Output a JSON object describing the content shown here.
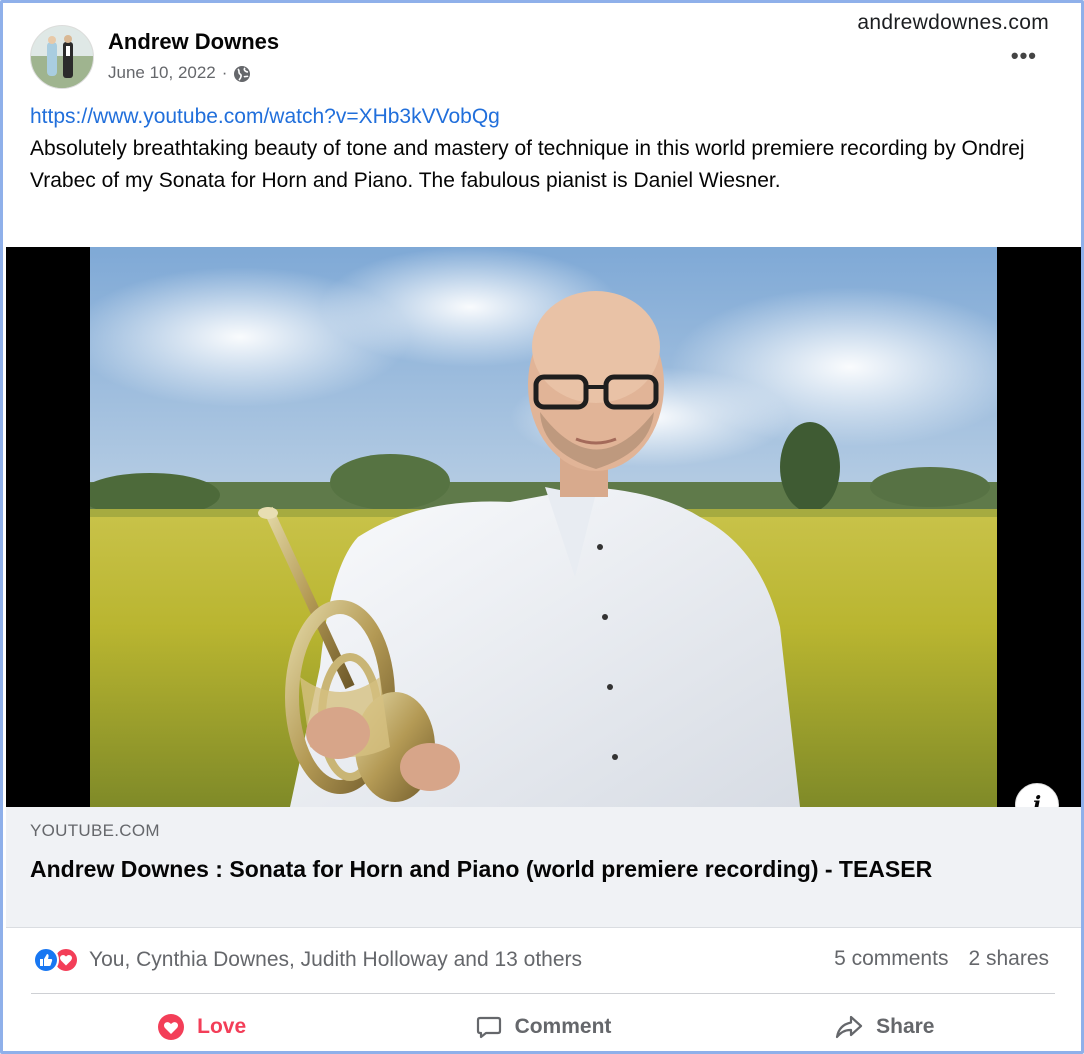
{
  "watermark": "andrewdownes.com",
  "post": {
    "author": "Andrew Downes",
    "date": "June 10, 2022",
    "separator": "·",
    "more_label": "•••",
    "link": "https://www.youtube.com/watch?v=XHb3kVVobQg",
    "text": "Absolutely breathtaking beauty of tone and mastery of technique in this world premiere recording by Ondrej Vrabec of my Sonata for Horn and Piano.  The fabulous pianist is Daniel Wiesner."
  },
  "link_preview": {
    "domain": "YOUTUBE.COM",
    "title": "Andrew Downes : Sonata for Horn and Piano (world premiere recording) - TEASER",
    "info_label": "i"
  },
  "engagement": {
    "reactions_text": "You, Cynthia Downes, Judith Holloway and 13 others",
    "comments": "5 comments",
    "shares": "2 shares",
    "reaction_icons": [
      "like-icon",
      "love-icon"
    ]
  },
  "actions": {
    "love_label": "Love",
    "comment_label": "Comment",
    "share_label": "Share"
  },
  "colors": {
    "border": "#8fb0ea",
    "link": "#216fdb",
    "love": "#f33e58",
    "like": "#1877f2",
    "secondary_text": "#65676b"
  }
}
